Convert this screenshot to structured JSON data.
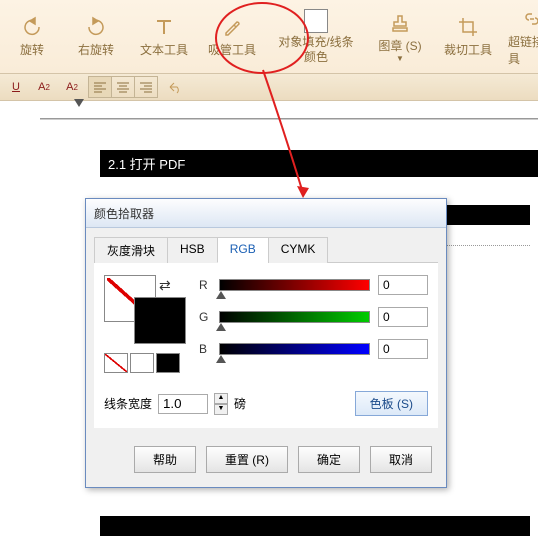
{
  "toolbar": {
    "rotate_left": "旋转",
    "rotate_right": "右旋转",
    "text_tool": "文本工具",
    "eyedropper": "吸管工具",
    "fill_color": "对象填充/线条颜色",
    "stamp": "图章 (S)",
    "crop": "裁切工具",
    "hyperlink": "超链接工具"
  },
  "fmt": {
    "underline": "U",
    "super": "A",
    "sub": "A"
  },
  "doc": {
    "section": "2.1 打开 PDF"
  },
  "dialog": {
    "title": "颜色拾取器",
    "tabs": {
      "gray": "灰度滑块",
      "hsb": "HSB",
      "rgb": "RGB",
      "cymk": "CYMK"
    },
    "r_label": "R",
    "g_label": "G",
    "b_label": "B",
    "r_val": "0",
    "g_val": "0",
    "b_val": "0",
    "line_width_label": "线条宽度",
    "line_width_val": "1.0",
    "pt_unit": "磅",
    "palette": "色板 (S)",
    "help": "帮助",
    "reset": "重置 (R)",
    "ok": "确定",
    "cancel": "取消"
  }
}
